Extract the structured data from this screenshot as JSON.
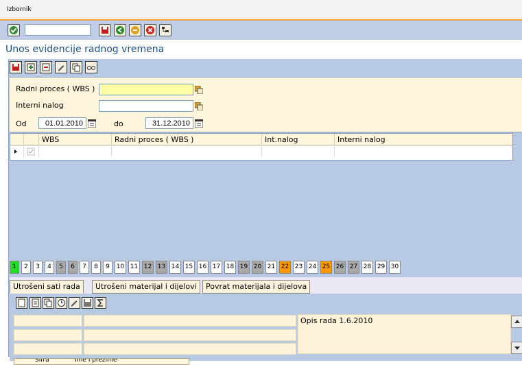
{
  "menu": {
    "label": "Izbornik"
  },
  "toolbar": {
    "command_value": ""
  },
  "page": {
    "title": "Unos evidencije radnog vremena"
  },
  "filter": {
    "wbs_label": "Radni proces ( WBS )",
    "wbs_value": "",
    "nalog_label": "Interni nalog",
    "nalog_value": "",
    "od_label": "Od",
    "od_value": "01.01.2010",
    "do_label": "do",
    "do_value": "31.12.2010"
  },
  "grid": {
    "columns": [
      "WBS",
      "Radni proces ( WBS )",
      "Int.nalog",
      "Interni nalog"
    ]
  },
  "days": {
    "labels": [
      "1",
      "2",
      "3",
      "4",
      "5",
      "6",
      "7",
      "8",
      "9",
      "10",
      "11",
      "12",
      "13",
      "14",
      "15",
      "16",
      "17",
      "18",
      "19",
      "20",
      "21",
      "22",
      "23",
      "24",
      "25",
      "26",
      "27",
      "28",
      "29",
      "30"
    ]
  },
  "tabs": {
    "t1": "Utrošeni sati rada",
    "t2": "Utrošeni materijal i dijelovi",
    "t3": "Povrat materijala i dijelova"
  },
  "lower": {
    "opis": "Opis rada 1.6.2010",
    "head_sifra": "Šifra",
    "head_ime": "Ime i prezime"
  },
  "colors": {
    "accent": "#f0a13a",
    "panel": "#b8c9e4",
    "input_highlight": "#ffffa8",
    "day_today": "#22dd22",
    "day_weekend": "#a9a9a9",
    "day_holiday": "#ff9900"
  }
}
